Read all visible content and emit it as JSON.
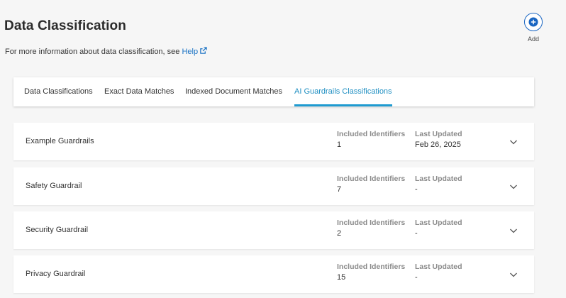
{
  "header": {
    "title": "Data Classification",
    "subtitle": "For more information about data classification, see",
    "help_link": "Help"
  },
  "actions": {
    "add_label": "Add"
  },
  "tabs": [
    {
      "label": "Data Classifications",
      "active": false
    },
    {
      "label": "Exact Data Matches",
      "active": false
    },
    {
      "label": "Indexed Document Matches",
      "active": false
    },
    {
      "label": "AI Guardrails Classifications",
      "active": true
    }
  ],
  "columns": {
    "identifiers": "Included Identifiers",
    "updated": "Last Updated"
  },
  "rows": [
    {
      "name": "Example Guardrails",
      "identifiers": "1",
      "updated": "Feb 26, 2025"
    },
    {
      "name": "Safety Guardrail",
      "identifiers": "7",
      "updated": "-"
    },
    {
      "name": "Security Guardrail",
      "identifiers": "2",
      "updated": "-"
    },
    {
      "name": "Privacy Guardrail",
      "identifiers": "15",
      "updated": "-"
    }
  ],
  "colors": {
    "accent": "#1f9bd1",
    "link": "#1a72c4",
    "add_button": "#1a66c2"
  },
  "icons": {
    "add": "plus-circle-icon",
    "external": "external-link-icon",
    "expand": "chevron-down-icon"
  }
}
